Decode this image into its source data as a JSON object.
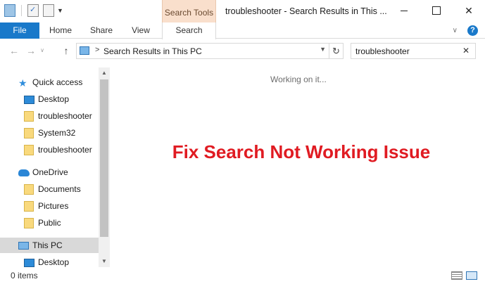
{
  "window": {
    "title": "troubleshooter - Search Results in This ...",
    "contextual_tab_group": "Search Tools"
  },
  "ribbon": {
    "file": "File",
    "tabs": [
      "Home",
      "Share",
      "View",
      "Search"
    ]
  },
  "address_bar": {
    "separator": ">",
    "location": "Search Results in This PC"
  },
  "search": {
    "value": "troubleshooter"
  },
  "nav_pane": {
    "quick_access": "Quick access",
    "quick_items": [
      "Desktop",
      "troubleshooter",
      "System32",
      "troubleshooter"
    ],
    "onedrive": "OneDrive",
    "onedrive_items": [
      "Documents",
      "Pictures",
      "Public"
    ],
    "this_pc": "This PC",
    "this_pc_items": [
      "Desktop"
    ]
  },
  "content": {
    "status_message": "Working on it...",
    "overlay_caption": "Fix Search Not Working Issue"
  },
  "status_bar": {
    "items_count": "0 items"
  },
  "colors": {
    "accent": "#1979ca",
    "contextual_tab": "#f9dfcc",
    "caption_red": "#e01b22"
  }
}
